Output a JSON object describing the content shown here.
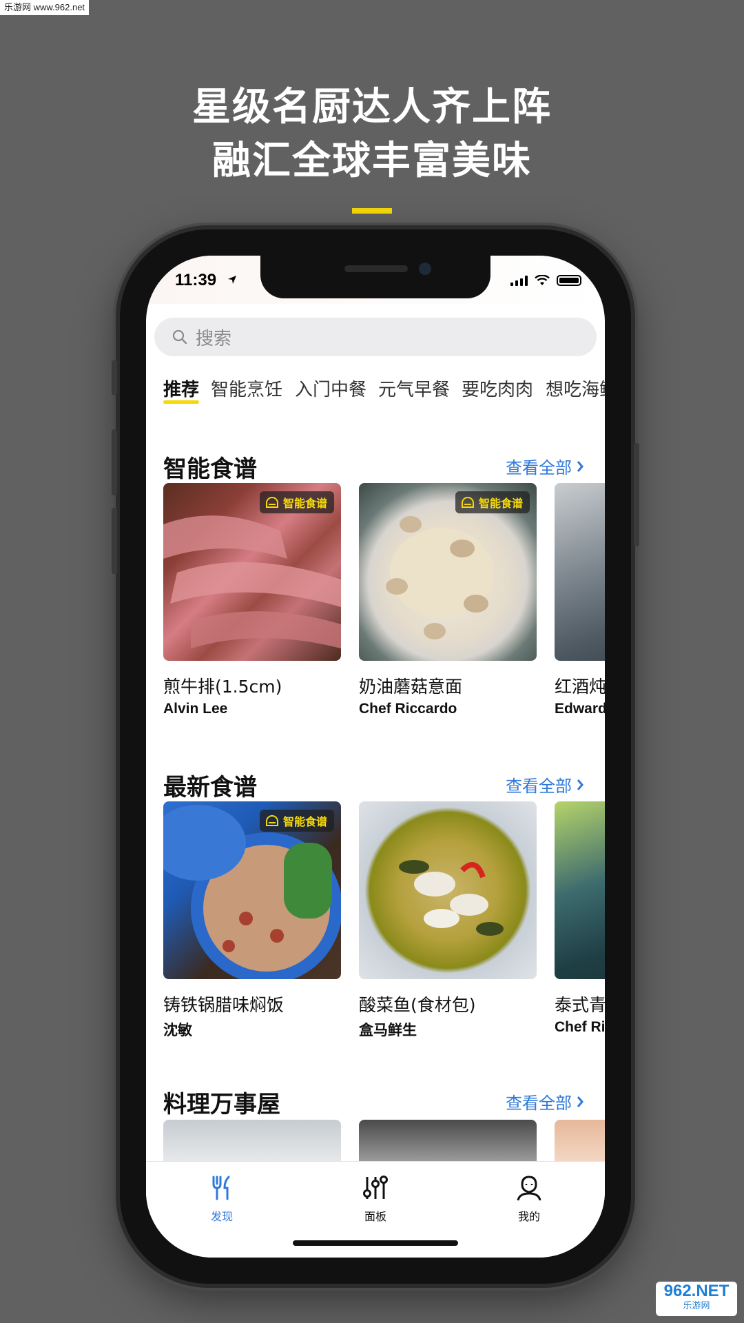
{
  "watermark_top": "乐游网 www.962.net",
  "promo": {
    "line1": "星级名厨达人齐上阵",
    "line2": "融汇全球丰富美味"
  },
  "status": {
    "time": "11:39"
  },
  "search": {
    "placeholder": "搜索"
  },
  "tabs": [
    "推荐",
    "智能烹饪",
    "入门中餐",
    "元气早餐",
    "要吃肉肉",
    "想吃海鲜"
  ],
  "badge_label": "智能食谱",
  "sections": [
    {
      "title": "智能食谱",
      "see_all": "查看全部",
      "cards": [
        {
          "title": "煎牛排(1.5cm)",
          "author": "Alvin Lee",
          "badge": true
        },
        {
          "title": "奶油蘑菇意面",
          "author": "Chef Riccardo",
          "badge": true
        },
        {
          "title": "红酒炖",
          "author": "Edward",
          "badge": false
        }
      ]
    },
    {
      "title": "最新食谱",
      "see_all": "查看全部",
      "cards": [
        {
          "title": "铸铁锅腊味焖饭",
          "author": "沈敏",
          "badge": true
        },
        {
          "title": "酸菜鱼(食材包)",
          "author": "盒马鲜生",
          "badge": false
        },
        {
          "title": "泰式青",
          "author": "Chef Ri",
          "badge": false
        }
      ]
    },
    {
      "title": "料理万事屋",
      "see_all": "查看全部"
    }
  ],
  "tabbar": [
    {
      "label": "发现",
      "icon": "fork-knife-icon",
      "active": true
    },
    {
      "label": "面板",
      "icon": "sliders-icon",
      "active": false
    },
    {
      "label": "我的",
      "icon": "person-icon",
      "active": false
    }
  ],
  "watermark_br": {
    "big": "962.NET",
    "small": "乐游网"
  },
  "colors": {
    "accent_yellow": "#f5d90a",
    "link_blue": "#2f79d9",
    "background": "#616161"
  }
}
